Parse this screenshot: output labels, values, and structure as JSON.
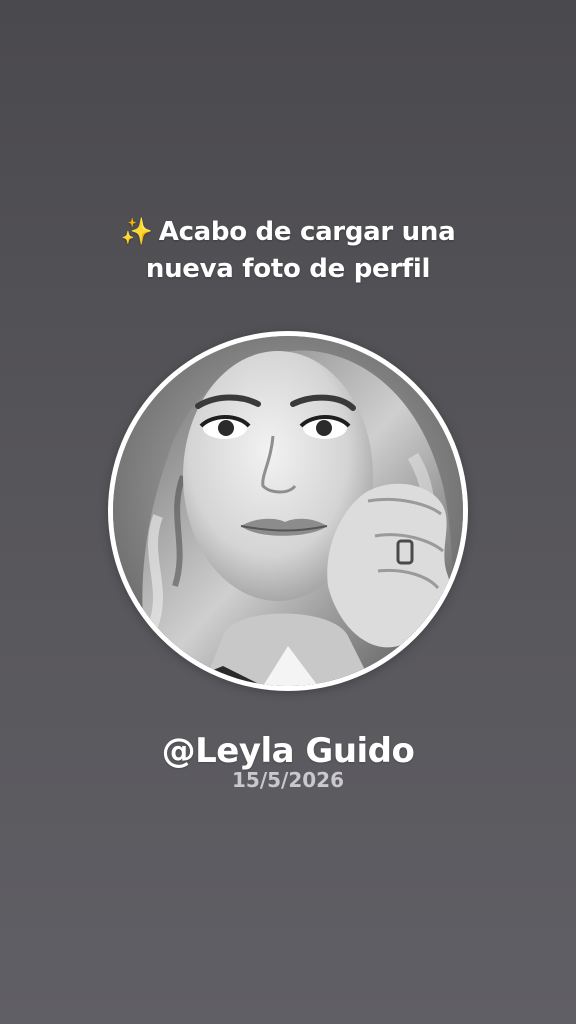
{
  "headline": {
    "sparkle": "✨",
    "line1": "Acabo de cargar una",
    "line2": "nueva foto de perfil"
  },
  "profile": {
    "username": "@Leyla Guido",
    "date": "15/5/2026",
    "photo_icon": "profile-photo-bw-portrait"
  },
  "colors": {
    "background_top": "#4a494d",
    "background_bottom": "#605f65",
    "text": "#ffffff",
    "date_text": "#c9c8cc",
    "frame": "#ffffff"
  }
}
